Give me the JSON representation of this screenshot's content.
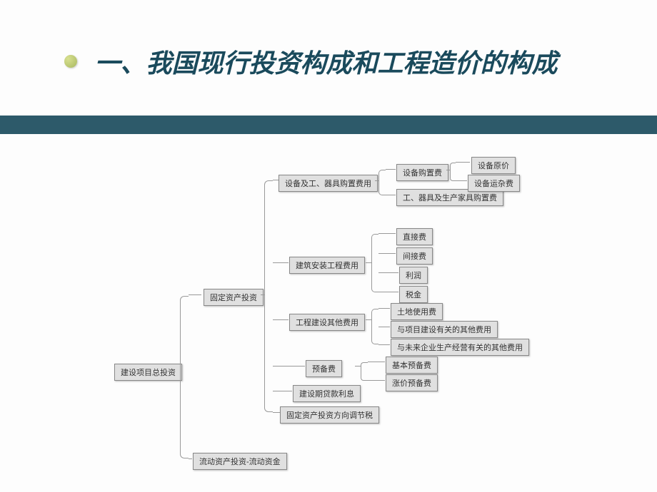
{
  "title": "一、我国现行投资构成和工程造价的构成",
  "chart_data": {
    "type": "tree",
    "root": {
      "label": "建设项目总投资",
      "children": [
        {
          "label": "固定资产投资",
          "children": [
            {
              "label": "设备及工、器具购置费用",
              "children": [
                {
                  "label": "设备购置费",
                  "children": [
                    {
                      "label": "设备原价"
                    },
                    {
                      "label": "设备运杂费"
                    }
                  ]
                },
                {
                  "label": "工、器具及生产家具购置费"
                }
              ]
            },
            {
              "label": "建筑安装工程费用",
              "children": [
                {
                  "label": "直接费"
                },
                {
                  "label": "间接费"
                },
                {
                  "label": "利润"
                },
                {
                  "label": "税金"
                }
              ]
            },
            {
              "label": "工程建设其他费用",
              "children": [
                {
                  "label": "土地使用费"
                },
                {
                  "label": "与项目建设有关的其他费用"
                },
                {
                  "label": "与未来企业生产经营有关的其他费用"
                }
              ]
            },
            {
              "label": "预备费",
              "children": [
                {
                  "label": "基本预备费"
                },
                {
                  "label": "涨价预备费"
                }
              ]
            },
            {
              "label": "建设期贷款利息"
            },
            {
              "label": "固定资产投资方向调节税"
            }
          ]
        },
        {
          "label": "流动资产投资-流动资金"
        }
      ]
    }
  },
  "nodes": {
    "root": "建设项目总投资",
    "fixed": "固定资产投资",
    "liquid": "流动资产投资-流动资金",
    "equip_tool": "设备及工、器具购置费用",
    "construct": "建筑安装工程费用",
    "other_eng": "工程建设其他费用",
    "reserve": "预备费",
    "loan": "建设期贷款利息",
    "tax_adj": "固定资产投资方向调节税",
    "equip_fee": "设备购置费",
    "tool_fee": "工、器具及生产家具购置费",
    "orig_price": "设备原价",
    "trans_fee": "设备运杂费",
    "direct": "直接费",
    "indirect": "间接费",
    "profit": "利润",
    "tax": "税金",
    "land": "土地使用费",
    "proj_other": "与项目建设有关的其他费用",
    "future_other": "与未来企业生产经营有关的其他费用",
    "basic_res": "基本预备费",
    "price_res": "涨价预备费"
  }
}
